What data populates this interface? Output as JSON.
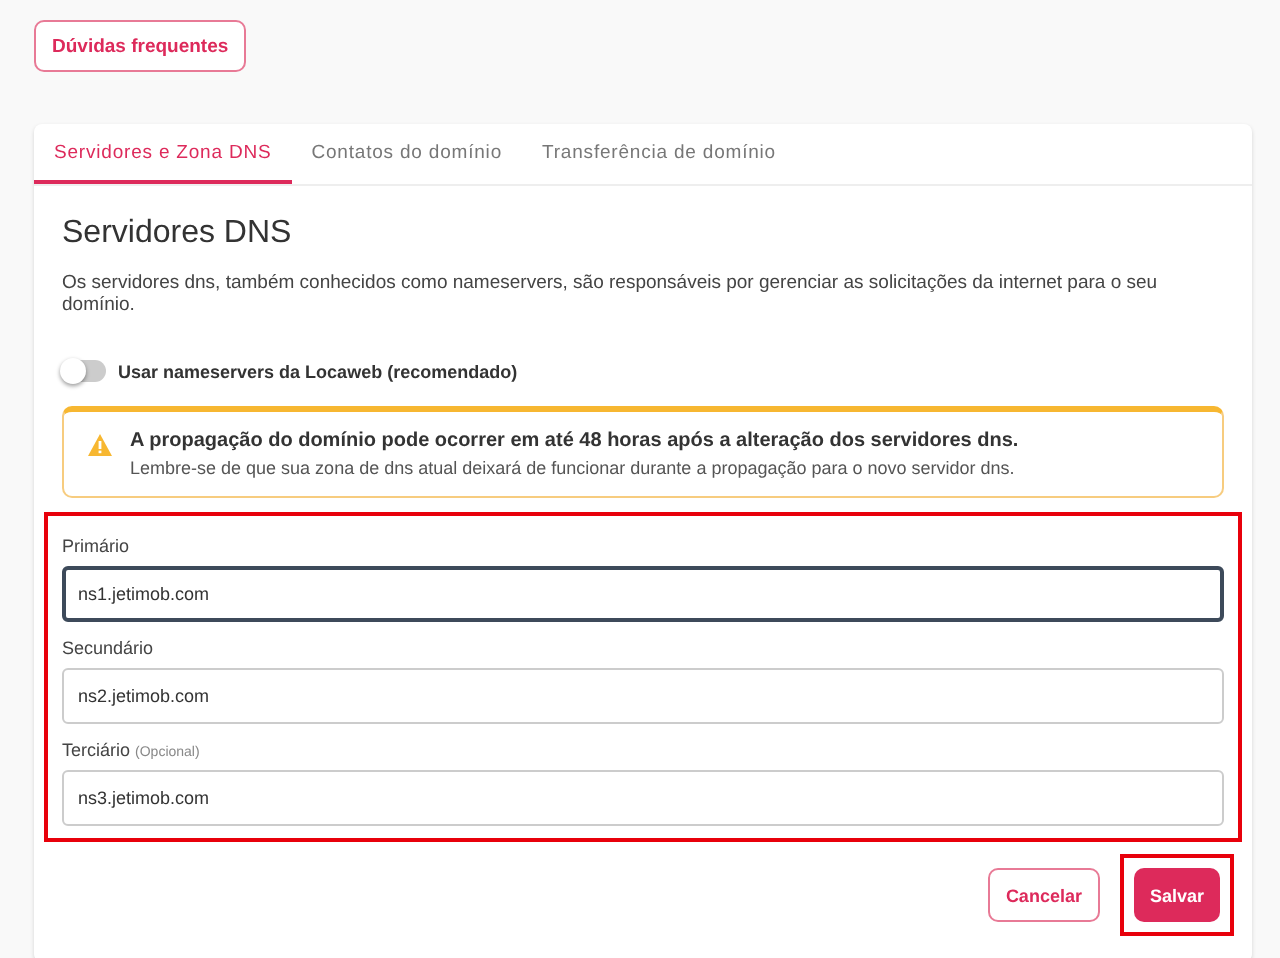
{
  "faq_button": "Dúvidas frequentes",
  "tabs": [
    {
      "label": "Servidores e Zona DNS",
      "selected": true
    },
    {
      "label": "Contatos do domínio",
      "selected": false
    },
    {
      "label": "Transferência de domínio",
      "selected": false
    }
  ],
  "heading": "Servidores DNS",
  "description": "Os servidores dns, também conhecidos como nameservers, são responsáveis por gerenciar as solicitações da internet para o seu domínio.",
  "toggle": {
    "label": "Usar nameservers da Locaweb (recomendado)",
    "on": false
  },
  "alert": {
    "title": "A propagação do domínio pode ocorrer em até 48 horas após a alteração dos servidores dns.",
    "text": "Lembre-se de que sua zona de dns atual deixará de funcionar durante a propagação para o novo servidor dns."
  },
  "fields": [
    {
      "label": "Primário",
      "value": "ns1.jetimob.com",
      "focused": true
    },
    {
      "label": "Secundário",
      "value": "ns2.jetimob.com",
      "focused": false
    },
    {
      "label": "Terciário",
      "hint": "(Opcional)",
      "value": "ns3.jetimob.com",
      "focused": false
    }
  ],
  "buttons": {
    "cancel": "Cancelar",
    "save": "Salvar"
  }
}
